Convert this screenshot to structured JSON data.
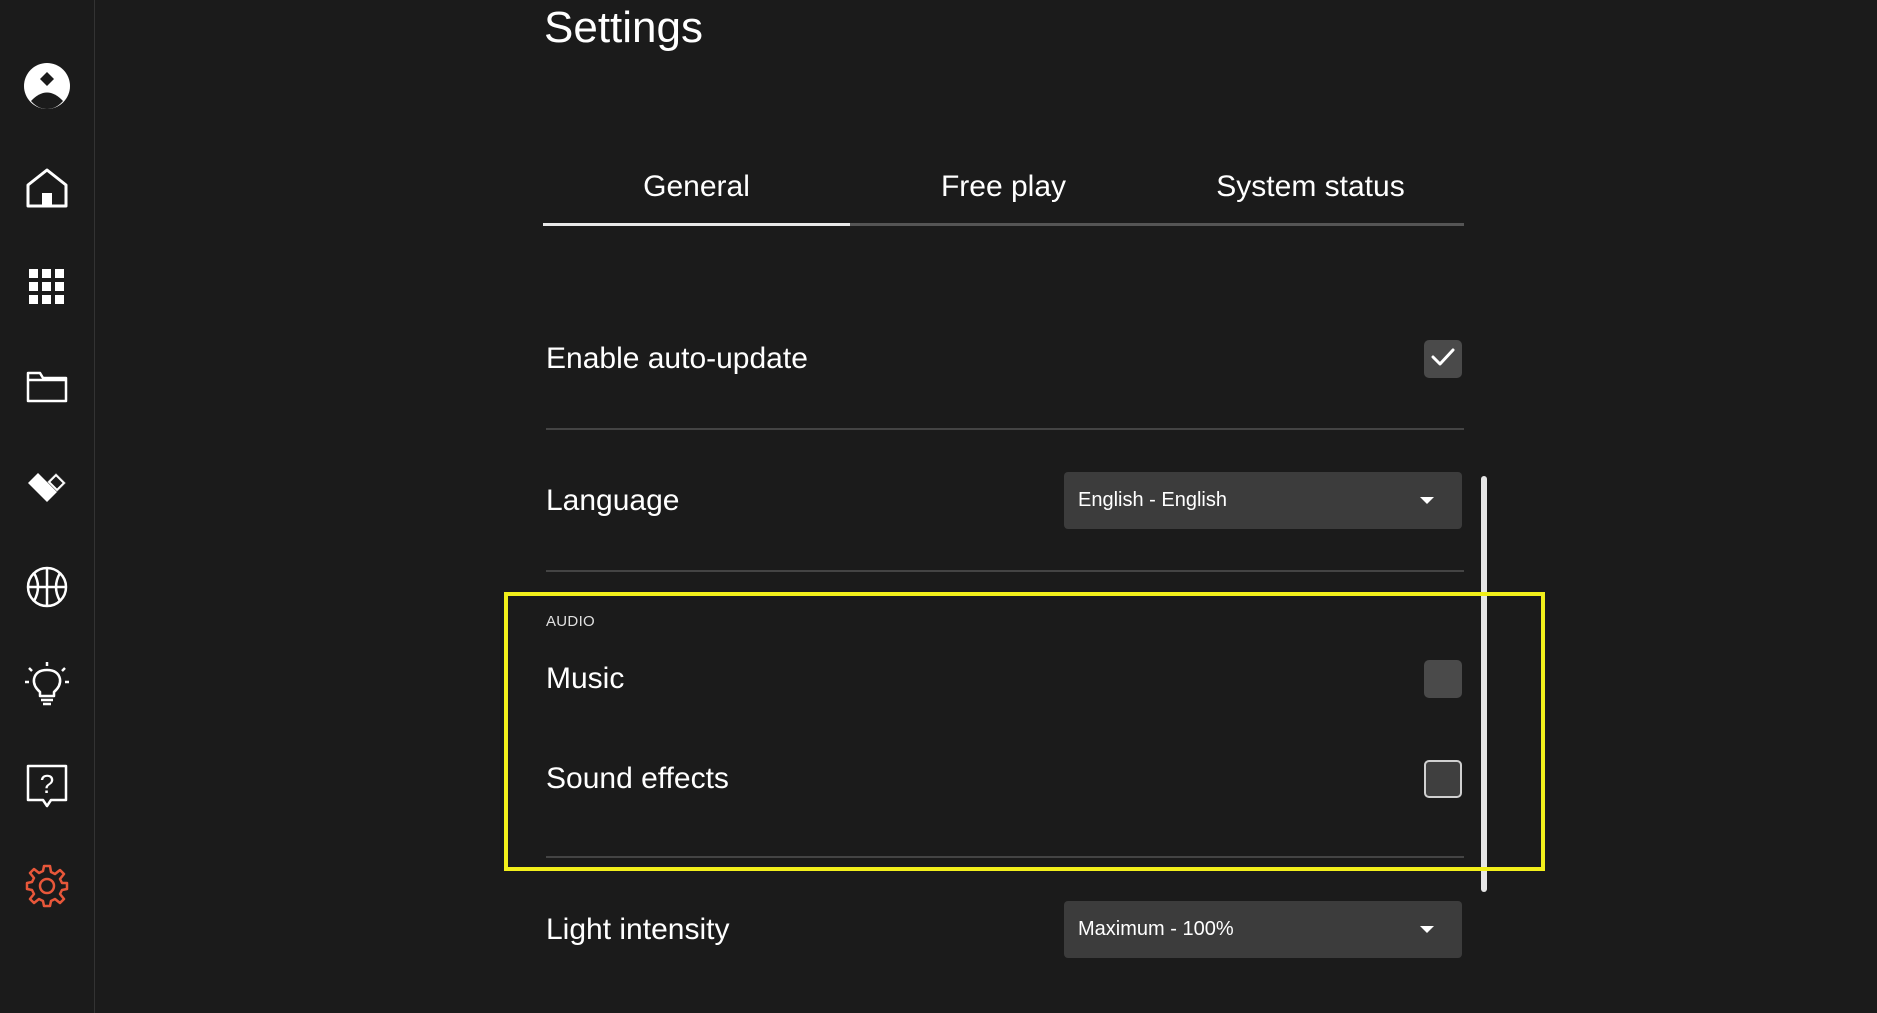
{
  "page": {
    "title": "Settings"
  },
  "sidebar": {
    "items": [
      {
        "name": "profile",
        "icon": "avatar-icon"
      },
      {
        "name": "home",
        "icon": "home-icon"
      },
      {
        "name": "apps",
        "icon": "grid-icon"
      },
      {
        "name": "files",
        "icon": "folder-icon"
      },
      {
        "name": "brand",
        "icon": "heart-diamond-icon"
      },
      {
        "name": "sports",
        "icon": "basketball-icon"
      },
      {
        "name": "ideas",
        "icon": "lightbulb-icon"
      },
      {
        "name": "help",
        "icon": "help-icon"
      },
      {
        "name": "settings",
        "icon": "gear-icon",
        "active": true
      }
    ]
  },
  "tabs": [
    {
      "label": "General",
      "active": true
    },
    {
      "label": "Free play",
      "active": false
    },
    {
      "label": "System status",
      "active": false
    }
  ],
  "general": {
    "auto_update": {
      "label": "Enable auto-update",
      "checked": true
    },
    "language": {
      "label": "Language",
      "value": "English - English"
    },
    "audio": {
      "section_label": "AUDIO",
      "music": {
        "label": "Music",
        "checked": false
      },
      "sound_effects": {
        "label": "Sound effects",
        "checked": false
      }
    },
    "light_intensity": {
      "label": "Light intensity",
      "value": "Maximum - 100%"
    }
  },
  "colors": {
    "background": "#1b1b1b",
    "active_icon": "#e8573a",
    "highlight": "#f2ef1b",
    "control_bg": "#3c3c3c"
  }
}
